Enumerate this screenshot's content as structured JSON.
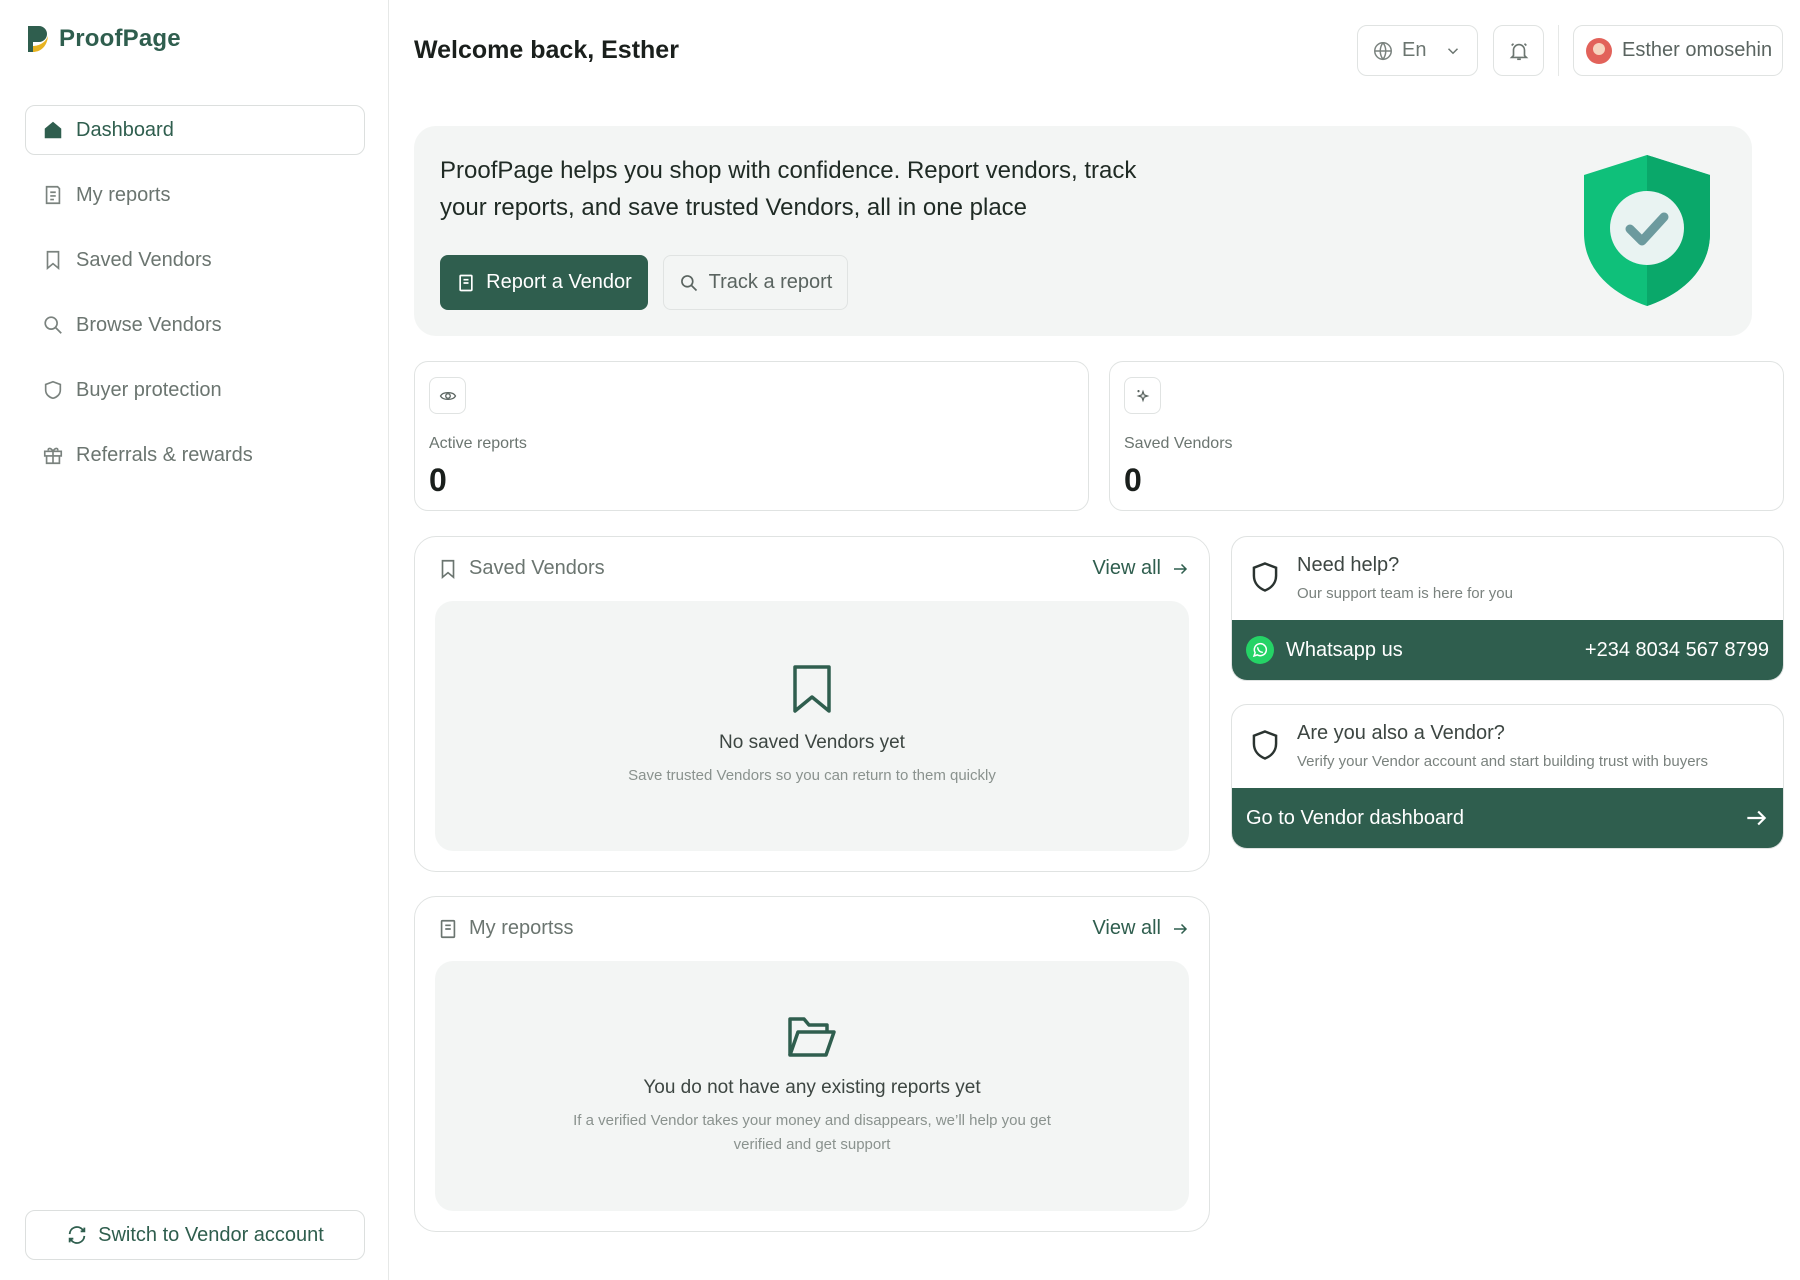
{
  "brand": {
    "name": "ProofPage",
    "color": "#2f5e4e"
  },
  "sidebar": {
    "items": [
      {
        "label": "Dashboard",
        "icon": "home-icon",
        "active": true
      },
      {
        "label": "My reports",
        "icon": "report-icon",
        "active": false
      },
      {
        "label": "Saved Vendors",
        "icon": "bookmark-icon",
        "active": false
      },
      {
        "label": "Browse Vendors",
        "icon": "search-icon",
        "active": false
      },
      {
        "label": "Buyer protection",
        "icon": "shield-icon",
        "active": false
      },
      {
        "label": "Referrals & rewards",
        "icon": "gift-icon",
        "active": false
      }
    ],
    "switch_label": "Switch to Vendor account"
  },
  "header": {
    "welcome": "Welcome back, Esther",
    "language": "En",
    "user_name": "Esther omosehin"
  },
  "hero": {
    "text": "ProofPage helps you shop with confidence. Report vendors, track your reports, and save trusted Vendors, all in one place",
    "primary_label": "Report a Vendor",
    "secondary_label": "Track a report"
  },
  "stats": [
    {
      "label": "Active reports",
      "value": "0",
      "icon": "eye-icon"
    },
    {
      "label": "Saved Vendors",
      "value": "0",
      "icon": "sparkle-icon"
    }
  ],
  "saved_panel": {
    "title": "Saved Vendors",
    "view_all": "View all",
    "empty_title": "No saved Vendors yet",
    "empty_sub": "Save trusted Vendors so you can return to them quickly"
  },
  "reports_panel": {
    "title": "My reportss",
    "view_all": "View all",
    "empty_title": "You do not have any existing reports yet",
    "empty_sub": "If a verified Vendor takes your money and disappears, we’ll help you get verified and get support"
  },
  "help": {
    "title": "Need help?",
    "sub": "Our support team is here for you",
    "whatsapp_label": "Whatsapp us",
    "phone": "+234 8034 567 8799"
  },
  "vendor": {
    "title": "Are you also a Vendor?",
    "sub": "Verify your Vendor account and start building trust with buyers",
    "cta": "Go to Vendor dashboard"
  }
}
